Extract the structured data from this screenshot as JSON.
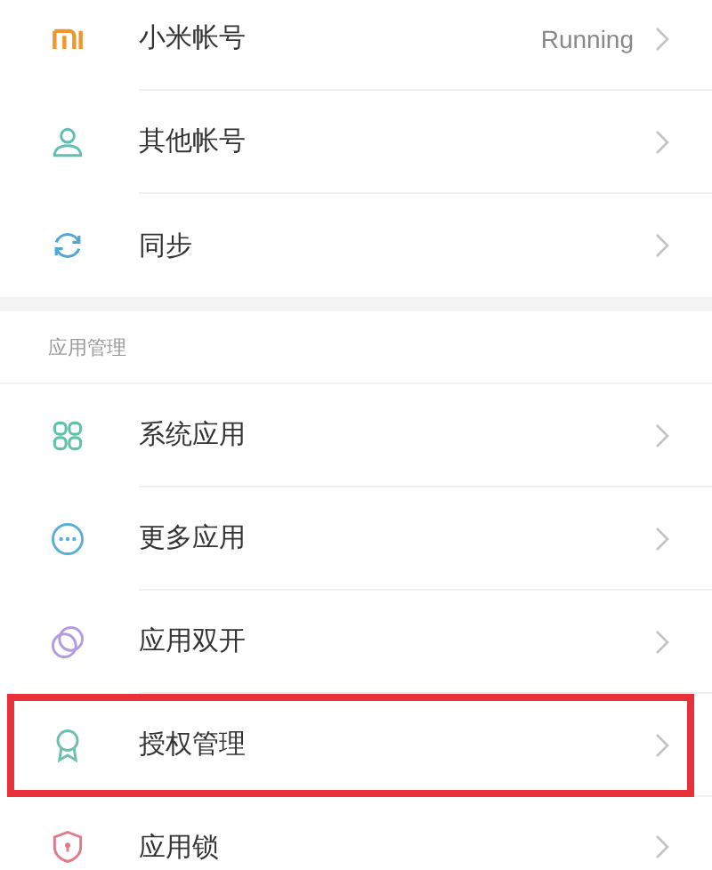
{
  "sections": [
    {
      "items": [
        {
          "kind": "mi",
          "label": "小米帐号",
          "value": "Running",
          "highlighted": false
        },
        {
          "kind": "person",
          "label": "其他帐号",
          "highlighted": false
        },
        {
          "kind": "sync",
          "label": "同步",
          "highlighted": false
        }
      ]
    },
    {
      "header": "应用管理",
      "items": [
        {
          "kind": "grid",
          "label": "系统应用",
          "highlighted": false
        },
        {
          "kind": "more",
          "label": "更多应用",
          "highlighted": false
        },
        {
          "kind": "dual",
          "label": "应用双开",
          "highlighted": false
        },
        {
          "kind": "badge",
          "label": "授权管理",
          "highlighted": true
        },
        {
          "kind": "shield",
          "label": "应用锁",
          "highlighted": false
        }
      ]
    }
  ]
}
